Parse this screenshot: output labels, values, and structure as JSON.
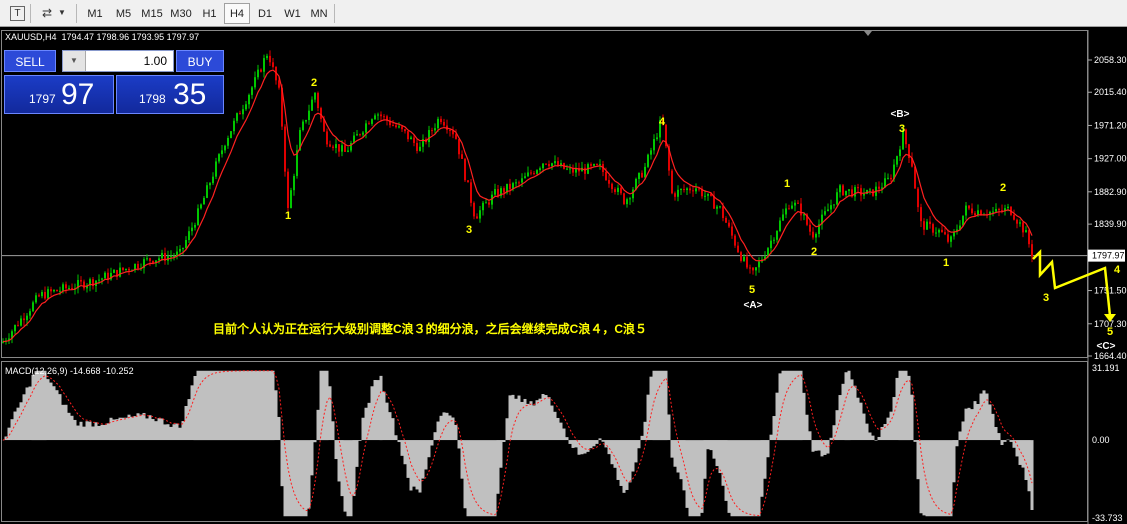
{
  "toolbar": {
    "tools": [
      "text-tool-icon",
      "objects-icon",
      "dropdown-arrow-icon"
    ],
    "timeframes": [
      "M1",
      "M5",
      "M15",
      "M30",
      "H1",
      "H4",
      "D1",
      "W1",
      "MN"
    ],
    "active_timeframe": "H4"
  },
  "chart": {
    "symbol_line": "XAUUSD,H4  1794.47 1798.96 1793.95 1797.97",
    "price_axis": [
      "2058.30",
      "2015.40",
      "1971.20",
      "1927.00",
      "1882.90",
      "1839.90",
      "1797.97",
      "1751.50",
      "1707.30",
      "1664.40"
    ],
    "current_price": "1797.97",
    "annotation": "目前个人认为正在运行大级别调整C浪３的细分浪，之后会继续完成C浪４，C浪５",
    "wave_labels": [
      "1",
      "2",
      "3",
      "4",
      "5",
      "<A>",
      "3",
      "<B>",
      "1",
      "2",
      "1",
      "2",
      "4",
      "3",
      "5",
      "<C>"
    ],
    "colors": {
      "bull": "#00c800",
      "bear": "#e00000",
      "ma": "#ff2020",
      "annot": "#ffff00",
      "macd_hist": "#c0c0c0"
    }
  },
  "trade_panel": {
    "sell_label": "SELL",
    "buy_label": "BUY",
    "lot": "1.00",
    "sell_small": "1797",
    "sell_big": "97",
    "buy_small": "1798",
    "buy_big": "35"
  },
  "macd": {
    "label": "MACD(12,26,9) -14.668 -10.252",
    "axis": [
      "31.191",
      "0.00",
      "-33.733"
    ]
  }
}
